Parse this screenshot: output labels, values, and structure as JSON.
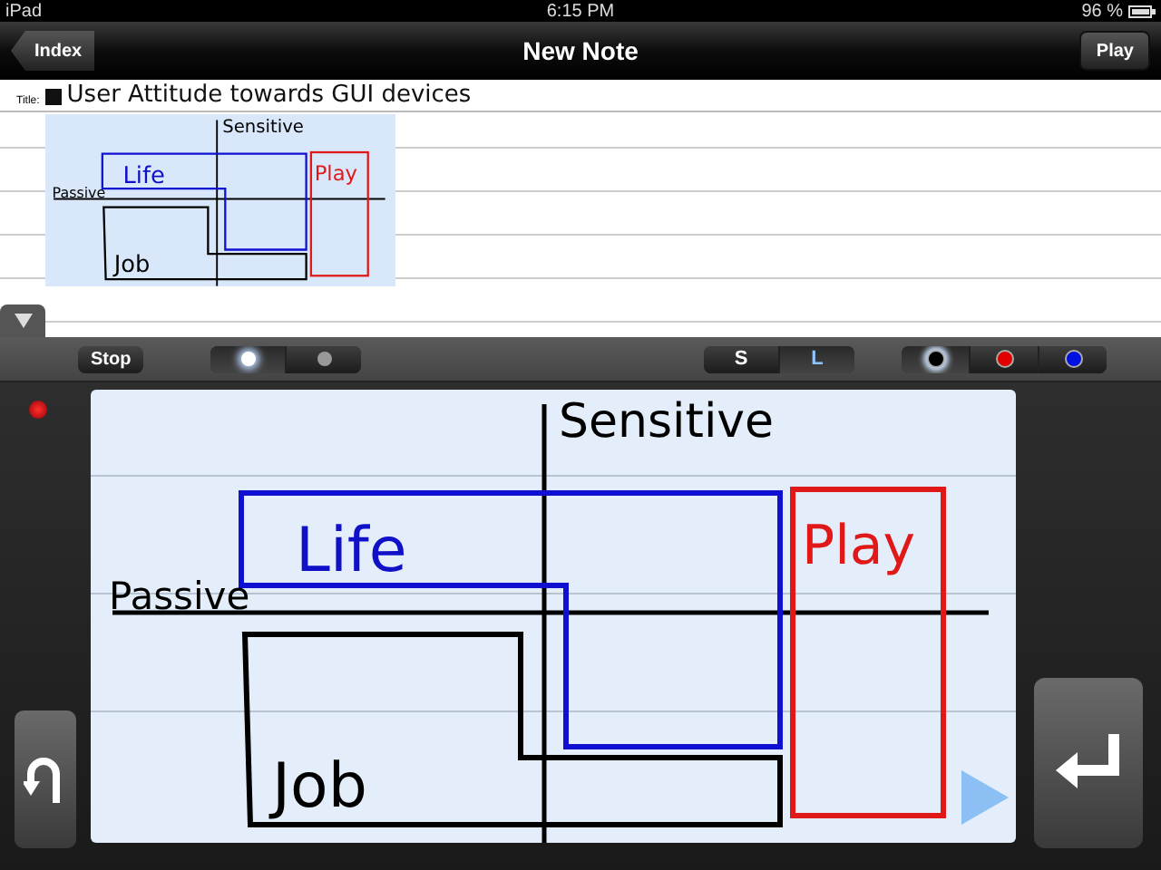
{
  "status_bar": {
    "device": "iPad",
    "time": "6:15 PM",
    "battery": "96 %"
  },
  "nav_bar": {
    "back_button": "Index",
    "title": "New Note",
    "action_button": "Play"
  },
  "note": {
    "title_label": "Title:",
    "title": "User Attitude towards GUI devices",
    "thumbnail_labels": [
      {
        "text": "Sensitive",
        "color": "#000000"
      },
      {
        "text": "Life",
        "color": "#1010c8"
      },
      {
        "text": "Play",
        "color": "#e01818"
      },
      {
        "text": "Passive",
        "color": "#000000"
      },
      {
        "text": "Job",
        "color": "#000000"
      }
    ]
  },
  "toolbar": {
    "stop_button": "Stop",
    "pen_modes": [
      {
        "kind": "glow",
        "selected": true
      },
      {
        "kind": "plain",
        "selected": false
      }
    ],
    "sizes": [
      {
        "label": "S",
        "selected": false
      },
      {
        "label": "L",
        "selected": true
      }
    ],
    "colors": [
      {
        "color": "#000000",
        "selected": true
      },
      {
        "color": "#e00000",
        "selected": false
      },
      {
        "color": "#0010e0",
        "selected": false
      }
    ]
  },
  "canvas": {
    "labels": [
      {
        "text": "Sensitive",
        "color": "#000000"
      },
      {
        "text": "Life",
        "color": "#1010c8"
      },
      {
        "text": "Play",
        "color": "#e01818"
      },
      {
        "text": "Passive",
        "color": "#000000"
      },
      {
        "text": "Job",
        "color": "#000000"
      }
    ]
  }
}
